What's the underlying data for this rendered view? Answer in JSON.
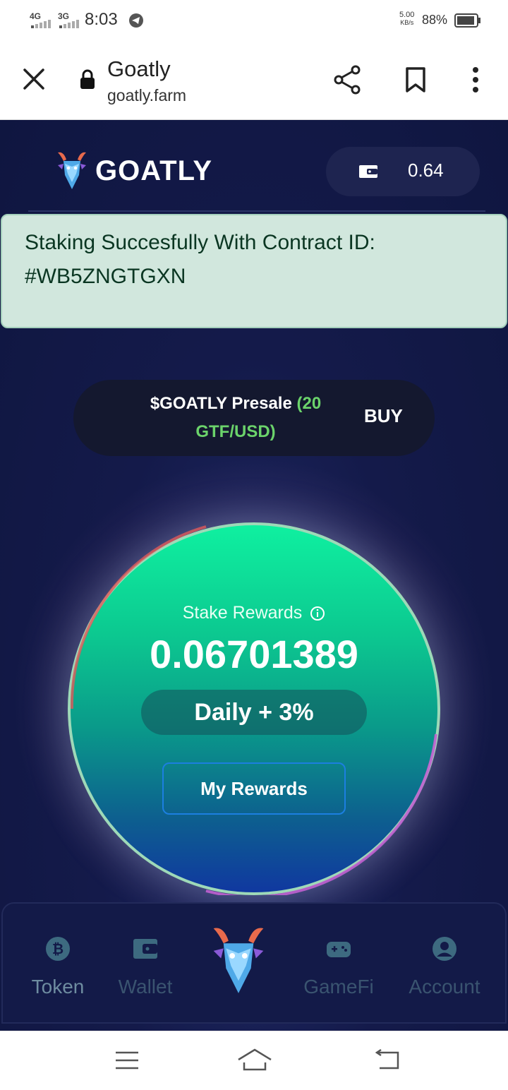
{
  "status_bar": {
    "net1": "4G",
    "net2": "3G",
    "time": "8:03",
    "speed_value": "5.00",
    "speed_unit": "KB/s",
    "battery": "88%"
  },
  "browser": {
    "title": "Goatly",
    "url": "goatly.farm"
  },
  "header": {
    "logo_text": "GOATLY",
    "wallet_amount": "0.64"
  },
  "alert": {
    "line1": "Staking Succesfully With Contract ID:",
    "line2": "#WB5ZNGTGXN"
  },
  "presale": {
    "label": "$GOATLY Presale",
    "rate": "(20 GTF/USD)",
    "buy_label": "BUY"
  },
  "stake": {
    "label": "Stake Rewards",
    "value": "0.06701389",
    "daily": "Daily + 3%",
    "my_rewards": "My Rewards"
  },
  "bottom_nav": {
    "items": [
      {
        "label": "Token",
        "icon": "coin-icon",
        "active": true
      },
      {
        "label": "Wallet",
        "icon": "wallet-icon",
        "active": false
      },
      {
        "label": "GameFi",
        "icon": "gamepad-icon",
        "active": false
      },
      {
        "label": "Account",
        "icon": "account-icon",
        "active": false
      }
    ],
    "center_icon": "goat-logo-icon"
  },
  "colors": {
    "page_bg": "#141a4a",
    "accent_green": "#0ff0a0",
    "alert_bg": "#d1e7dd",
    "presale_green": "#6bd36b",
    "button_border": "#1c7fe0"
  }
}
